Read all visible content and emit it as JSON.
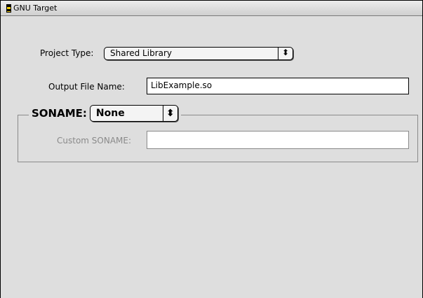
{
  "window": {
    "title": "GNU Target"
  },
  "project_type": {
    "label": "Project Type:",
    "value": "Shared Library",
    "arrows": "⬍"
  },
  "output_file": {
    "label": "Output File Name:",
    "value": "LibExample.so"
  },
  "soname": {
    "label": "SONAME:",
    "value": "None",
    "arrows": "⬍",
    "custom_label": "Custom SONAME:",
    "custom_value": ""
  }
}
